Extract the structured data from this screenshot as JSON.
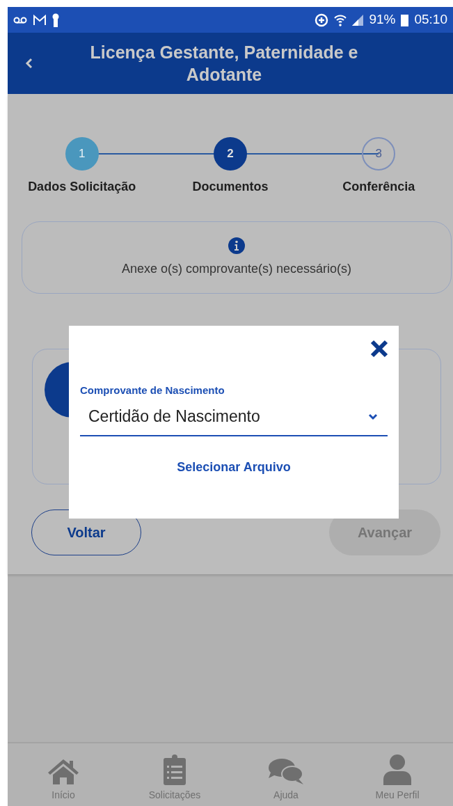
{
  "status_bar": {
    "battery": "91%",
    "time": "05:10"
  },
  "header": {
    "title": "Licença Gestante, Paternidade e Adotante"
  },
  "steps": [
    {
      "number": "1",
      "label": "Dados Solicitação",
      "completed": true,
      "selected": false
    },
    {
      "number": "2",
      "label": "Documentos",
      "completed": false,
      "selected": true
    },
    {
      "number": "3",
      "label": "Conferência",
      "completed": false,
      "selected": false
    }
  ],
  "info": {
    "text": "Anexe o(s) comprovante(s) necessário(s)"
  },
  "buttons": [
    {
      "label": "Voltar",
      "disabled": false
    },
    {
      "label": "Avançar",
      "disabled": true
    }
  ],
  "modal": {
    "field_label": "Comprovante de Nascimento",
    "value": "Certidão de Nascimento",
    "link": "Selecionar Arquivo"
  },
  "bottom_nav": [
    {
      "label": "Início"
    },
    {
      "label": "Solicitações"
    },
    {
      "label": "Ajuda"
    },
    {
      "label": "Meu Perfil"
    }
  ]
}
